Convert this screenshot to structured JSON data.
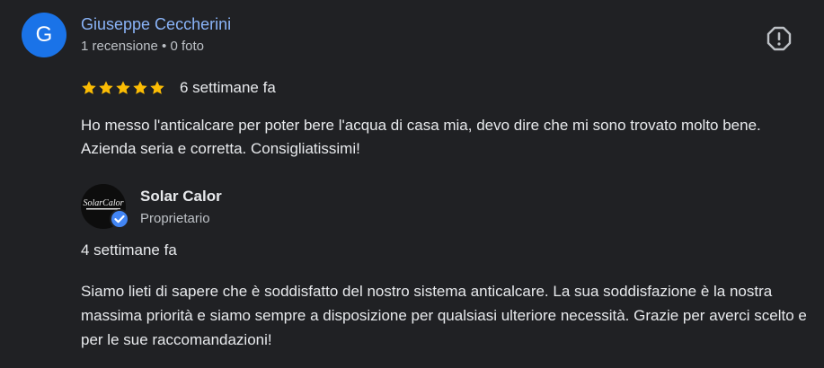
{
  "review": {
    "avatar_initial": "G",
    "avatar_color": "#1a73e8",
    "reviewer_name": "Giuseppe Ceccherini",
    "reviewer_name_color": "#8ab4f8",
    "reviewer_meta": "1 recensione • 0 foto",
    "rating": 5,
    "rating_max": 5,
    "star_color": "#fbbc04",
    "date": "6 settimane fa",
    "text": "Ho messo l'anticalcare per poter bere l'acqua di casa mia, devo dire che mi sono trovato molto bene. Azienda seria e corretta. Consigliatissimi!",
    "report_icon": "report-flag-icon"
  },
  "owner_reply": {
    "logo_text": "SolarCalor",
    "verified_color": "#4285f4",
    "owner_name": "Solar Calor",
    "owner_role": "Proprietario",
    "date": "4 settimane fa",
    "text": "Siamo lieti di sapere che è soddisfatto del nostro sistema anticalcare. La sua soddisfazione è la nostra massima priorità e siamo sempre a disposizione per qualsiasi ulteriore necessità. Grazie per averci scelto e per le sue raccomandazioni!"
  }
}
